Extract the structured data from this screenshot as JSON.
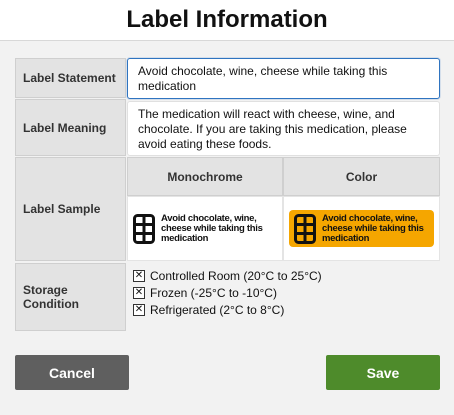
{
  "dialog": {
    "title": "Label Information"
  },
  "fields": {
    "statement": {
      "label": "Label Statement",
      "value": "Avoid chocolate, wine, cheese while taking this medication"
    },
    "meaning": {
      "label": "Label Meaning",
      "value": "The medication will react with cheese, wine, and chocolate. If you are taking this medication, please avoid eating these foods."
    },
    "sample": {
      "label": "Label Sample",
      "monochrome_header": "Monochrome",
      "color_header": "Color",
      "sample_text": "Avoid chocolate, wine, cheese while taking this medication",
      "icon": "grid-icon",
      "color_background": "#f5a600"
    },
    "storage": {
      "label": "Storage Condition",
      "options": [
        {
          "label": "Controlled Room (20°C to 25°C)",
          "checked": true
        },
        {
          "label": "Frozen (-25°C to -10°C)",
          "checked": true
        },
        {
          "label": "Refrigerated (2°C to 8°C)",
          "checked": true
        }
      ]
    }
  },
  "buttons": {
    "cancel": "Cancel",
    "save": "Save",
    "cancel_color": "#5f5f5f",
    "save_color": "#4e8b2b"
  }
}
